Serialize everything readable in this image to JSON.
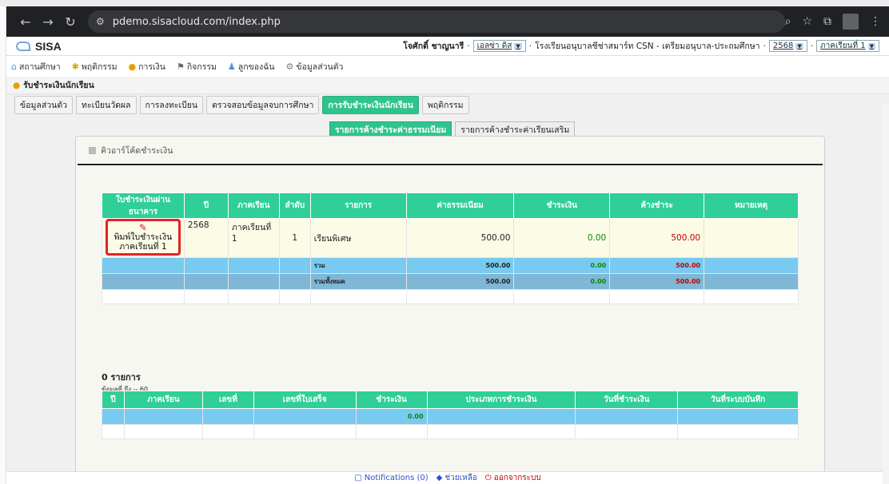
{
  "browser": {
    "url": "pdemo.sisacloud.com/index.php"
  },
  "app": {
    "logo": "SISA",
    "user": "โจศักดิ์ ชาญนารี",
    "role": "เอลซ่า ดิส",
    "school": "โรงเรียนอนุบาลชีช่าสมาร์ท CSN - เตรียมอนุบาล-ประถมศึกษา",
    "year": "2568",
    "term": "ภาคเรียนที่ 1"
  },
  "menu": [
    {
      "label": "สถานศึกษา",
      "icon": "house-icon"
    },
    {
      "label": "พฤติกรรม",
      "icon": "behavior-icon"
    },
    {
      "label": "การเงิน",
      "icon": "money-icon"
    },
    {
      "label": "กิจกรรม",
      "icon": "activity-icon"
    },
    {
      "label": "ลูกของฉัน",
      "icon": "children-icon"
    },
    {
      "label": "ข้อมูลส่วนตัว",
      "icon": "profile-icon"
    }
  ],
  "page_title": "รับชำระเงินนักเรียน",
  "subtabs": [
    "ข้อมูลส่วนตัว",
    "ทะเบียนวัดผล",
    "การลงทะเบียน",
    "ตรวจสอบข้อมูลจบการศึกษา",
    "การรับชำระเงินนักเรียน",
    "พฤติกรรม"
  ],
  "paytabs": [
    "รายการค้างชำระค่าธรรมเนียม",
    "รายการค้างชำระค่าเรียนเสริม"
  ],
  "panel_title": "คิวอาร์โค้ดชำระเงิน",
  "fees_table": {
    "headers": [
      "ใบชำระเงินผ่านธนาคาร",
      "ปี",
      "ภาคเรียน",
      "ลำดับ",
      "รายการ",
      "ค่าธรรมเนียม",
      "ชำระเงิน",
      "ค้างชำระ",
      "หมายเหตุ"
    ],
    "row": {
      "print_label": "พิมพ์ใบชำระเงิน ภาคเรียนที่ 1",
      "year": "2568",
      "term": "ภาคเรียนที่ 1",
      "seq": "1",
      "item": "เรียนพิเศษ",
      "fee": "500.00",
      "paid": "0.00",
      "due": "500.00"
    },
    "sum": {
      "label": "รวม",
      "fee": "500.00",
      "paid": "0.00",
      "due": "500.00"
    },
    "total": {
      "label": "รวมทั้งหมด",
      "fee": "500.00",
      "paid": "0.00",
      "due": "500.00"
    }
  },
  "history": {
    "count": "0 รายการ",
    "range": "ข้อมูลที่ ถึง -- 60",
    "headers": [
      "ปี",
      "ภาคเรียน",
      "เลขที่",
      "เลขที่ใบเสร็จ",
      "ชำระเงิน",
      "ประเภทการชำระเงิน",
      "วันที่ชำระเงิน",
      "วันที่ระบบบันทึก"
    ],
    "sum_paid": "0.00"
  },
  "footer": {
    "notifications": "Notifications (0)",
    "help": "ช่วยเหลือ",
    "logout": "ออกจากระบบ"
  }
}
